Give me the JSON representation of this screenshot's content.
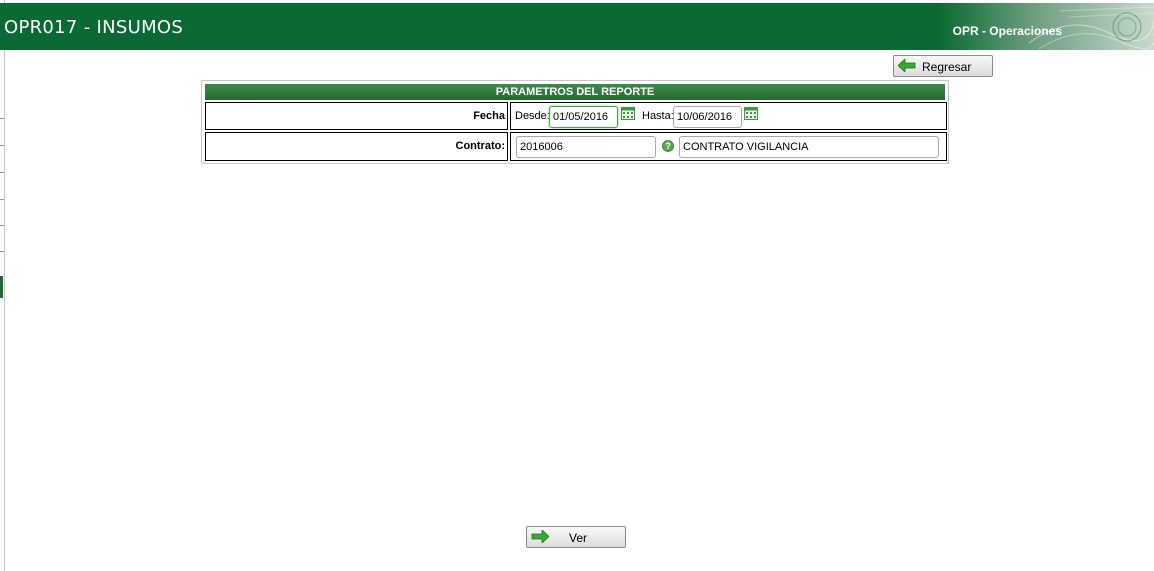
{
  "header": {
    "title": "OPR017 - INSUMOS",
    "module": "OPR - Operaciones",
    "brand_color": "#0b6a33"
  },
  "toolbar": {
    "back_label": "Regresar",
    "back_icon": "arrow-left-icon"
  },
  "panel": {
    "title": "PARAMETROS DEL REPORTE",
    "fecha": {
      "label": "Fecha",
      "desde_label": "Desde:",
      "desde_value": "01/05/2016",
      "hasta_label": "Hasta:",
      "hasta_value": "10/06/2016",
      "calendar_icon": "calendar-icon"
    },
    "contrato": {
      "label": "Contrato:",
      "code_value": "2016006",
      "help_icon": "help-icon",
      "name_value": "CONTRATO VIGILANCIA"
    }
  },
  "footer": {
    "view_label": "Ver",
    "view_icon": "arrow-right-icon"
  }
}
